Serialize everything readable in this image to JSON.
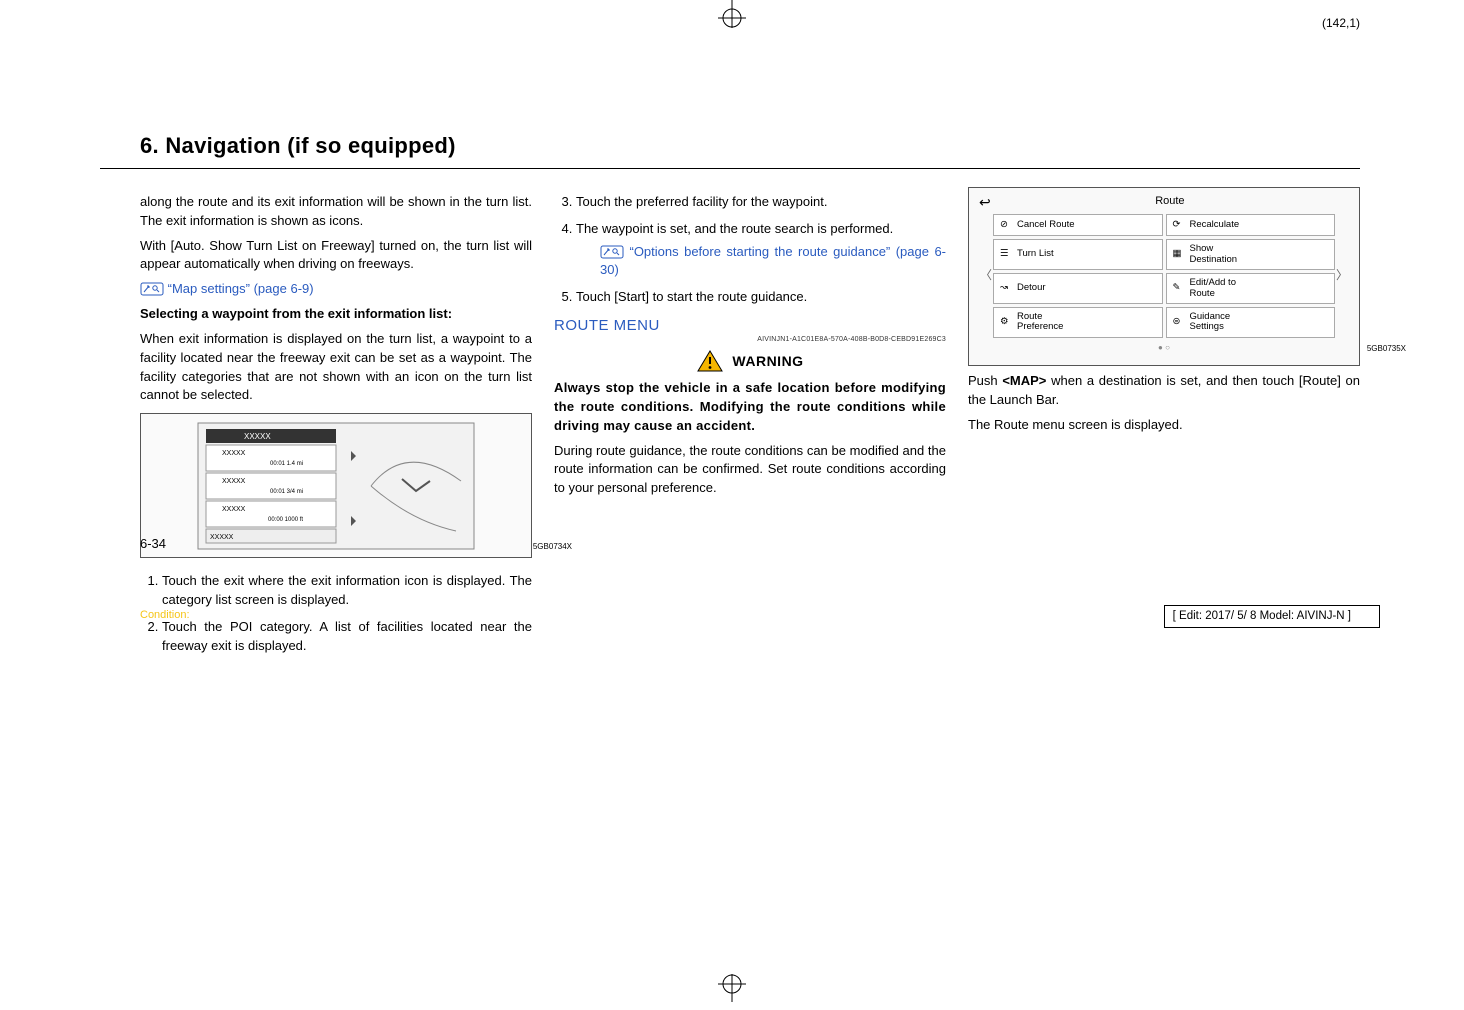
{
  "page_indicator": "(142,1)",
  "section_title": "6. Navigation (if so equipped)",
  "col1": {
    "p1": "along the route and its exit information will be shown in the turn list. The exit information is shown as icons.",
    "p2": "With [Auto. Show Turn List on Freeway] turned on, the turn list will appear automatically when driving on freeways.",
    "link1": "“Map settings” (page 6-9)",
    "h_sel": "Selecting a waypoint from the exit information list:",
    "p3": "When exit information is displayed on the turn list, a waypoint to a facility located near the freeway exit can be set as a waypoint. The facility categories that are not shown with an icon on the turn list cannot be selected.",
    "fig_label": "5GB0734X",
    "steps": [
      "Touch the exit where the exit information icon is displayed. The category list screen is displayed.",
      "Touch the POI category. A list of facilities located near the freeway exit is displayed."
    ]
  },
  "col2": {
    "steps": [
      "Touch the preferred facility for the waypoint.",
      "The waypoint is set, and the route search is performed.",
      "Touch [Start] to start the route guidance."
    ],
    "step4_link": "“Options before starting the route guidance” (page 6-30)",
    "h_route": "ROUTE MENU",
    "guid": "AIVINJN1-A1C01E8A-570A-408B-B0D8-CEBD91E269C3",
    "warn_title": "WARNING",
    "warn_body": "Always stop the vehicle in a safe location before modifying the route conditions. Modifying the route conditions while driving may cause an accident.",
    "p_after": "During route guidance, the route conditions can be modified and the route information can be confirmed. Set route conditions according to your personal preference."
  },
  "col3": {
    "fig_label": "5GB0735X",
    "route_menu": {
      "title": "Route",
      "left": [
        "Cancel Route",
        "Turn List",
        "Detour",
        "Route\nPreference"
      ],
      "right": [
        "Recalculate",
        "Show\nDestination",
        "Edit/Add to\nRoute",
        "Guidance\nSettings"
      ]
    },
    "p1_a": "Push ",
    "p1_b": "<MAP>",
    "p1_c": " when a destination is set, and then touch [Route] on the Launch Bar.",
    "p2": "The Route menu screen is displayed."
  },
  "footer_page": "6-34",
  "condition": "Condition:",
  "editbox": "[ Edit: 2017/ 5/ 8    Model:  AIVINJ-N ]"
}
